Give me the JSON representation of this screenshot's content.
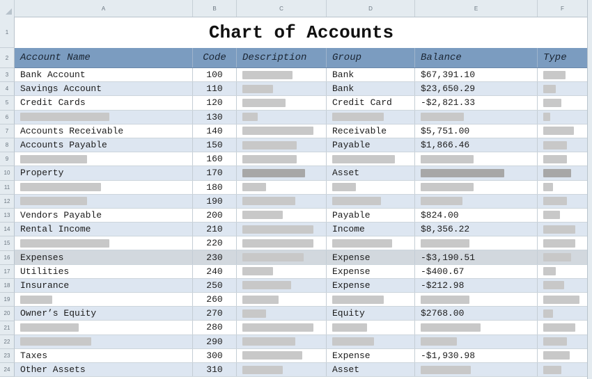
{
  "title": "Chart of Accounts",
  "column_letters": [
    "A",
    "B",
    "C",
    "D",
    "E",
    "F"
  ],
  "headers": {
    "account_name": "Account Name",
    "code": "Code",
    "description": "Description",
    "group": "Group",
    "balance": "Balance",
    "type": "Type"
  },
  "rows": [
    {
      "num": "3",
      "name": "Bank Account",
      "code": "100",
      "group": "Bank",
      "balance": "$67,391.10"
    },
    {
      "num": "4",
      "name": "Savings Account",
      "code": "110",
      "group": "Bank",
      "balance": "$23,650.29"
    },
    {
      "num": "5",
      "name": "Credit Cards",
      "code": "120",
      "group": "Credit Card",
      "balance": "-$2,821.33"
    },
    {
      "num": "6",
      "name": "",
      "code": "130",
      "group": "",
      "balance": ""
    },
    {
      "num": "7",
      "name": "Accounts Receivable",
      "code": "140",
      "group": "Receivable",
      "balance": "$5,751.00"
    },
    {
      "num": "8",
      "name": "Accounts Payable",
      "code": "150",
      "group": "Payable",
      "balance": "$1,866.46"
    },
    {
      "num": "9",
      "name": "",
      "code": "160",
      "group": "",
      "balance": ""
    },
    {
      "num": "10",
      "name": "Property",
      "code": "170",
      "group": "Asset",
      "balance": ""
    },
    {
      "num": "11",
      "name": "",
      "code": "180",
      "group": "",
      "balance": ""
    },
    {
      "num": "12",
      "name": "",
      "code": "190",
      "group": "",
      "balance": ""
    },
    {
      "num": "13",
      "name": "Vendors Payable",
      "code": "200",
      "group": "Payable",
      "balance": "$824.00"
    },
    {
      "num": "14",
      "name": "Rental Income",
      "code": "210",
      "group": "Income",
      "balance": "$8,356.22"
    },
    {
      "num": "15",
      "name": "",
      "code": "220",
      "group": "",
      "balance": ""
    },
    {
      "num": "16",
      "name": "Expenses",
      "code": "230",
      "group": "Expense",
      "balance": "-$3,190.51"
    },
    {
      "num": "17",
      "name": "Utilities",
      "code": "240",
      "group": "Expense",
      "balance": "-$400.67"
    },
    {
      "num": "18",
      "name": "Insurance",
      "code": "250",
      "group": "Expense",
      "balance": "-$212.98"
    },
    {
      "num": "19",
      "name": "",
      "code": "260",
      "group": "",
      "balance": ""
    },
    {
      "num": "20",
      "name": "Owner’s Equity",
      "code": "270",
      "group": "Equity",
      "balance": "$2768.00"
    },
    {
      "num": "21",
      "name": "",
      "code": "280",
      "group": "",
      "balance": ""
    },
    {
      "num": "22",
      "name": "",
      "code": "290",
      "group": "",
      "balance": ""
    },
    {
      "num": "23",
      "name": "Taxes",
      "code": "300",
      "group": "Expense",
      "balance": "-$1,930.98"
    },
    {
      "num": "24",
      "name": "Other Assets",
      "code": "310",
      "group": "Asset",
      "balance": ""
    }
  ]
}
